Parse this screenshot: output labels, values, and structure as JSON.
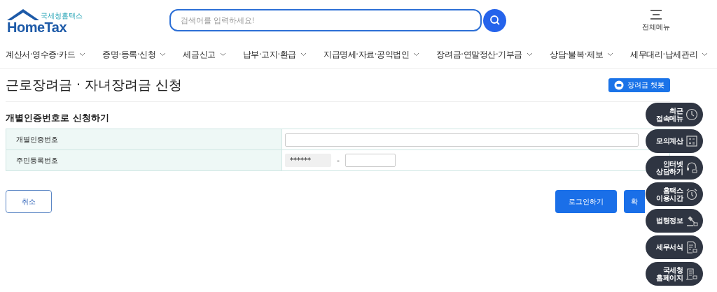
{
  "logo": {
    "subtitle": "국세청홈택스",
    "name": "HomeTax"
  },
  "search": {
    "placeholder": "검색어를 입력하세요!"
  },
  "all_menu": {
    "label": "전체메뉴"
  },
  "nav": [
    "계산서·영수증·카드",
    "증명·등록·신청",
    "세금신고",
    "납부·고지·환급",
    "지급명세·자료·공익법인",
    "장려금·연말정산·기부금",
    "상담·불복·제보",
    "세무대리·납세관리"
  ],
  "page_title": "근로장려금 · 자녀장려금 신청",
  "chatbot_button": "장려금 챗봇",
  "section_title": "개별인증번호로 신청하기",
  "form": [
    {
      "kind": "text",
      "label": "개별인증번호"
    },
    {
      "kind": "rrn",
      "label": "주민등록번호",
      "front": "******",
      "separator": "-"
    }
  ],
  "buttons": {
    "cancel": "취소",
    "login": "로그인하기",
    "confirm": "확"
  },
  "quick_menu": [
    {
      "kind": "clock",
      "label": "최근\n접속메뉴"
    },
    {
      "kind": "calculator",
      "label": "모의계산"
    },
    {
      "kind": "chat",
      "label": "인터넷\n상담하기"
    },
    {
      "kind": "alarm",
      "label": "홈택스\n이용시간"
    },
    {
      "kind": "gavel",
      "label": "법령정보"
    },
    {
      "kind": "document",
      "label": "세무서식"
    },
    {
      "kind": "building",
      "label": "국세청\n홈페이지"
    }
  ]
}
